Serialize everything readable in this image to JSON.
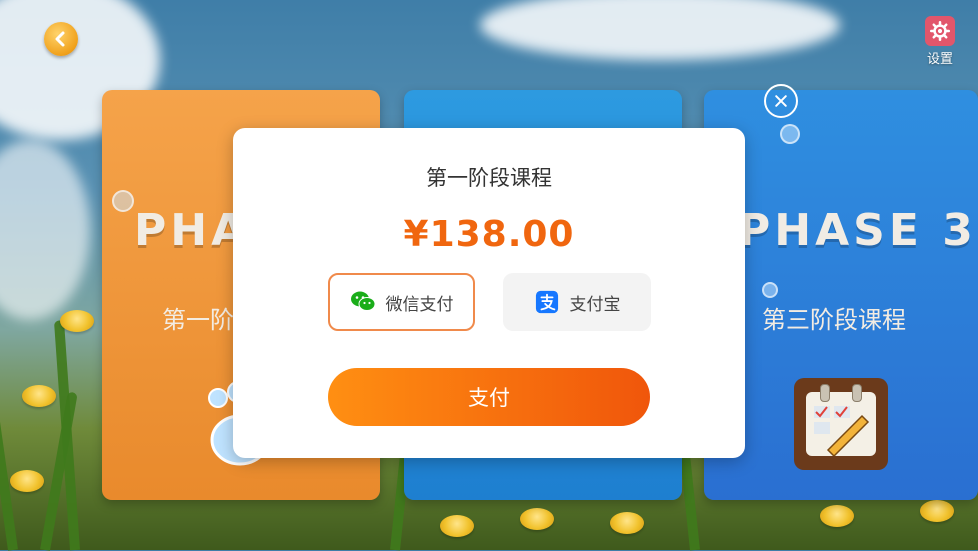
{
  "header": {
    "back_icon": "chevron-left-icon",
    "settings_label": "设置",
    "settings_icon": "gear-icon"
  },
  "cards": [
    {
      "title": "PHA",
      "subtitle": "第一阶",
      "color": "#f09a3c"
    },
    {
      "title": "",
      "subtitle": "",
      "color": "#2a8fdc"
    },
    {
      "title": "PHASE 3",
      "subtitle": "第三阶段课程",
      "color": "#2b7fd8"
    }
  ],
  "modal": {
    "title": "第一阶段课程",
    "price": "¥138.00",
    "price_color": "#f0660f",
    "close_icon": "close-circle-icon",
    "payment_options": [
      {
        "label": "微信支付",
        "icon": "wechat-icon",
        "selected": true
      },
      {
        "label": "支付宝",
        "icon": "alipay-icon",
        "selected": false
      }
    ],
    "submit_label": "支付",
    "accent": "#f57c12"
  }
}
